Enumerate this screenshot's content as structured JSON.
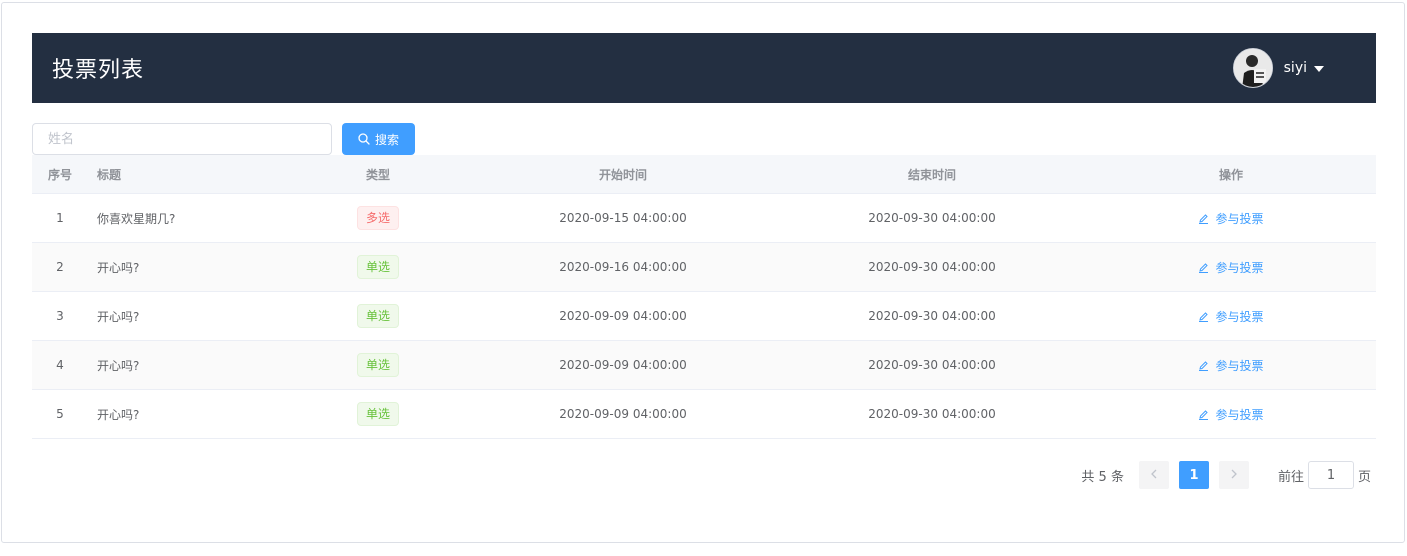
{
  "header": {
    "title": "投票列表",
    "username": "siyi"
  },
  "search": {
    "placeholder": "姓名",
    "value": "",
    "button_label": "搜索"
  },
  "table": {
    "columns": {
      "idx": "序号",
      "title": "标题",
      "type": "类型",
      "start": "开始时间",
      "end": "结束时间",
      "op": "操作"
    },
    "rows": [
      {
        "idx": "1",
        "title": "你喜欢星期几?",
        "type": "多选",
        "type_style": "danger",
        "start": "2020-09-15 04:00:00",
        "end": "2020-09-30 04:00:00",
        "op": "参与投票"
      },
      {
        "idx": "2",
        "title": "开心吗?",
        "type": "单选",
        "type_style": "success",
        "start": "2020-09-16 04:00:00",
        "end": "2020-09-30 04:00:00",
        "op": "参与投票"
      },
      {
        "idx": "3",
        "title": "开心吗?",
        "type": "单选",
        "type_style": "success",
        "start": "2020-09-09 04:00:00",
        "end": "2020-09-30 04:00:00",
        "op": "参与投票"
      },
      {
        "idx": "4",
        "title": "开心吗?",
        "type": "单选",
        "type_style": "success",
        "start": "2020-09-09 04:00:00",
        "end": "2020-09-30 04:00:00",
        "op": "参与投票"
      },
      {
        "idx": "5",
        "title": "开心吗?",
        "type": "单选",
        "type_style": "success",
        "start": "2020-09-09 04:00:00",
        "end": "2020-09-30 04:00:00",
        "op": "参与投票"
      }
    ]
  },
  "pagination": {
    "total_text": "共 5 条",
    "current_page": "1",
    "goto_prefix": "前往",
    "goto_value": "1",
    "goto_suffix": "页"
  },
  "icons": {
    "search": "search-icon",
    "edit": "edit-icon",
    "prev": "chevron-left-icon",
    "next": "chevron-right-icon",
    "caret": "caret-down-icon"
  },
  "colors": {
    "header_bg": "#232f41",
    "primary": "#409eff",
    "danger": "#f56c6c",
    "success": "#67c23a"
  }
}
